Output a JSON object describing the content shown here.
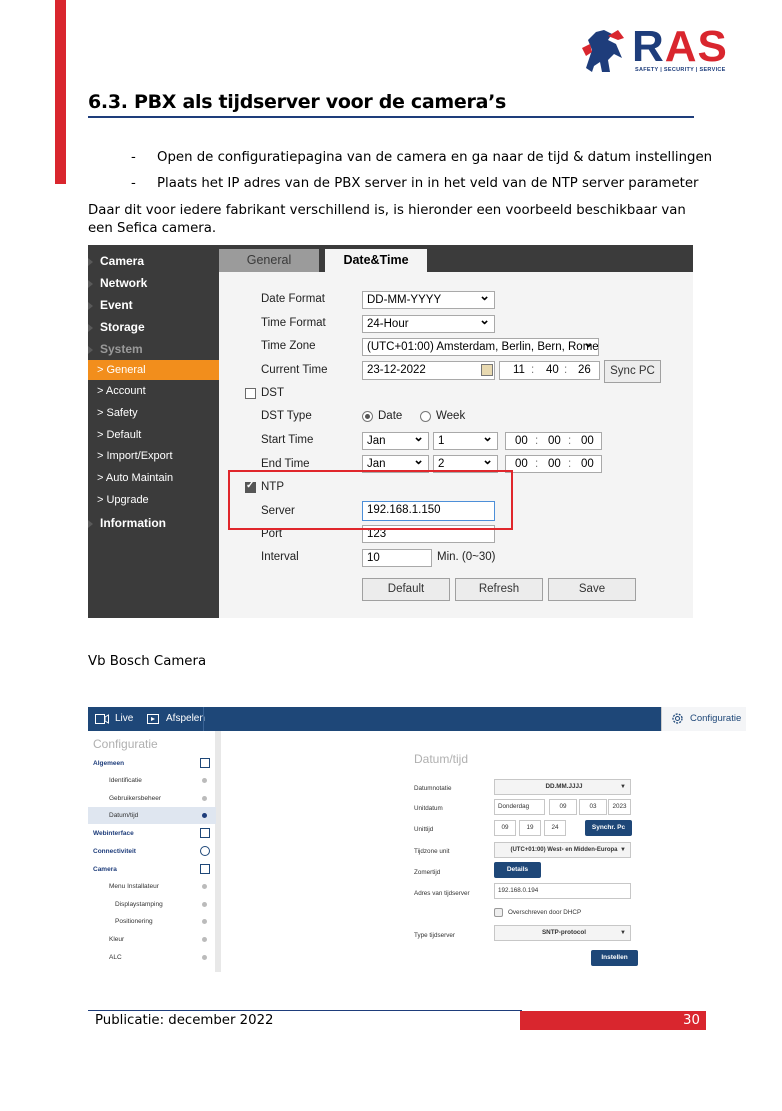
{
  "logo": {
    "r": "R",
    "as": "AS",
    "sub": "SAFETY | SECURITY | SERVICE"
  },
  "heading": "6.3. PBX als tijdserver voor de camera’s",
  "bullets": [
    "Open de configuratiepagina van de camera en ga naar de tijd & datum instellingen",
    "Plaats het IP adres van de PBX server in in het veld van de NTP server parameter"
  ],
  "dash": "-",
  "paragraph": "Daar dit voor iedere fabrikant verschillend is, is hieronder een voorbeeld beschikbaar van een Sefica camera.",
  "dahua": {
    "sidebar": {
      "camera": "Camera",
      "network": "Network",
      "event": "Event",
      "storage": "Storage",
      "system": "System",
      "general": "> General",
      "account": "> Account",
      "safety": "> Safety",
      "default": "> Default",
      "import_export": "> Import/Export",
      "auto_maintain": "> Auto Maintain",
      "upgrade": "> Upgrade",
      "information": "Information"
    },
    "tabs": {
      "general": "General",
      "datetime": "Date&Time"
    },
    "labels": {
      "date_format": "Date Format",
      "time_format": "Time Format",
      "time_zone": "Time Zone",
      "current_time": "Current Time",
      "dst": "DST",
      "dst_type": "DST Type",
      "start_time": "Start Time",
      "end_time": "End Time",
      "ntp": "NTP",
      "server": "Server",
      "port": "Port",
      "interval": "Interval"
    },
    "values": {
      "date_format": "DD-MM-YYYY",
      "time_format": "24-Hour",
      "time_zone": "(UTC+01:00) Amsterdam, Berlin, Bern, Rome",
      "current_date": "23-12-2022",
      "cur_h": "11",
      "cur_m": "40",
      "cur_s": "26",
      "radio_date": "Date",
      "radio_week": "Week",
      "start_month": "Jan",
      "start_day": "1",
      "end_month": "Jan",
      "end_day": "2",
      "t00": "00",
      "server": "192.168.1.150",
      "port": "123",
      "interval": "10",
      "interval_hint": "Min. (0~30)",
      "colon": ":"
    },
    "buttons": {
      "sync_pc": "Sync PC",
      "default": "Default",
      "refresh": "Refresh",
      "save": "Save"
    }
  },
  "vb_caption": "Vb Bosch Camera",
  "bosch": {
    "top": {
      "live": "Live",
      "afspelen": "Afspelen",
      "configuratie": "Configuratie"
    },
    "side_title": "Configuratie",
    "side": {
      "algemeen": "Algemeen",
      "identificatie": "Identificatie",
      "gebruikersbeheer": "Gebruikersbeheer",
      "datumtijd": "Datum/tijd",
      "webinterface": "Webinterface",
      "connectiviteit": "Connectiviteit",
      "camera": "Camera",
      "menu_installateur": "Menu Installateur",
      "displaystamping": "Displaystamping",
      "positionering": "Positionering",
      "kleur": "Kleur",
      "alc": "ALC"
    },
    "heading": "Datum/tijd",
    "labels": {
      "datumnotatie": "Datumnotatie",
      "unitdatum": "Unitdatum",
      "unittijd": "Unittijd",
      "tijdzone": "Tijdzone unit",
      "zomertijd": "Zomertijd",
      "adres": "Adres van tijdserver",
      "type": "Type tijdserver"
    },
    "values": {
      "datumnotatie": "DD.MM.JJJJ",
      "dag": "Donderdag",
      "d1": "09",
      "d2": "03",
      "d3": "2023",
      "t1": "09",
      "t2": "19",
      "t3": "24",
      "tijdzone": "(UTC+01:00) West- en Midden-Europa",
      "adres": "192.168.0.194",
      "dhcp": "Overschreven door DHCP",
      "type": "SNTP-protocol"
    },
    "buttons": {
      "synchr": "Synchr. Pc",
      "details": "Details",
      "instellen": "Instellen"
    }
  },
  "footer": {
    "publication": "Publicatie: december 2022",
    "page": "30"
  },
  "colors": {
    "brand_red": "#d9262e",
    "brand_blue": "#1e3d7b",
    "dahua_orange": "#f28e1c",
    "bosch_blue": "#1e4778"
  }
}
